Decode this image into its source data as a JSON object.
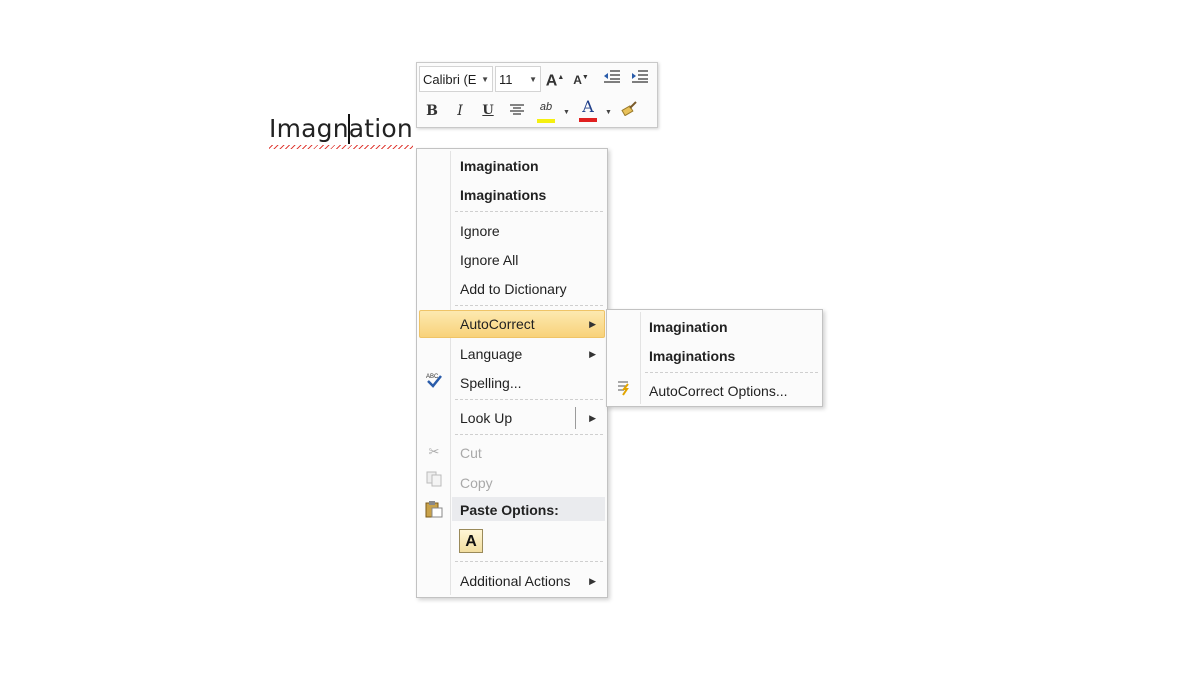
{
  "document": {
    "word": "Imagnation"
  },
  "mini_toolbar": {
    "font_name": "Calibri (E",
    "font_size": "11",
    "grow_font": "A",
    "shrink_font": "A",
    "bold": "B",
    "italic": "I",
    "underline": "U",
    "highlight_glyph": "ab",
    "font_color_glyph": "A",
    "colors": {
      "highlight": "#f5f010",
      "font_color": "#e02020"
    }
  },
  "context_menu": {
    "suggestions": [
      "Imagination",
      "Imaginations"
    ],
    "ignore": "Ignore",
    "ignore_all": "Ignore All",
    "add_to_dictionary": "Add to Dictionary",
    "autocorrect": "AutoCorrect",
    "language": "Language",
    "spelling": "Spelling...",
    "look_up": "Look Up",
    "cut": "Cut",
    "copy": "Copy",
    "paste_options": "Paste Options:",
    "paste_keep_text": "A",
    "additional_actions": "Additional Actions",
    "hover_color": "#f8d27a"
  },
  "autocorrect_submenu": {
    "suggestions": [
      "Imagination",
      "Imaginations"
    ],
    "options": "AutoCorrect Options..."
  }
}
